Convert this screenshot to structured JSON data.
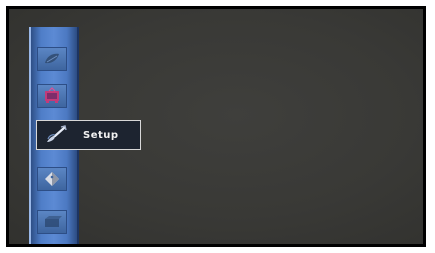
{
  "menu": {
    "items": [
      {
        "icon": "leaf-icon",
        "selected": false
      },
      {
        "icon": "tv-icon",
        "selected": false
      },
      {
        "icon": "wrench-icon",
        "label": "Setup",
        "selected": true
      },
      {
        "icon": "tag-icon",
        "selected": false
      },
      {
        "icon": "box-icon",
        "selected": false
      }
    ]
  }
}
